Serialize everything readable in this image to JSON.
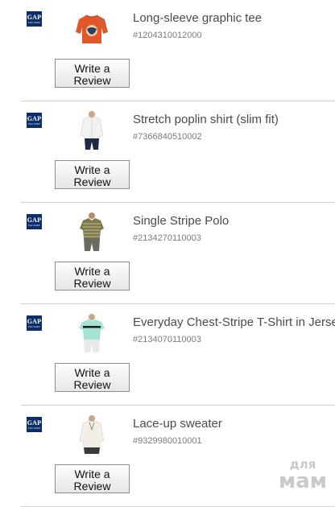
{
  "brand": {
    "logo_text": "GAP",
    "logo_subtext": "FACTORY",
    "logo_color": "#0b2e6b"
  },
  "review_button_label_line1": "Write a",
  "review_button_label_line2": "Review",
  "products": [
    {
      "title": "Long-sleeve graphic tee",
      "sku": "#1204310012000",
      "image": "orange-graphic-tee"
    },
    {
      "title": "Stretch poplin shirt (slim fit)",
      "sku": "#7366840510002",
      "image": "white-poplin-shirt"
    },
    {
      "title": "Single Stripe Polo",
      "sku": "#2134270110003",
      "image": "olive-stripe-polo"
    },
    {
      "title": "Everyday Chest-Stripe T-Shirt in Jersey",
      "sku": "#2134070110003",
      "image": "mint-chest-stripe-tee"
    },
    {
      "title": "Lace-up sweater",
      "sku": "#9329980010001",
      "image": "cream-lace-up-sweater"
    }
  ],
  "watermark": {
    "line1": "для",
    "line2": "мам"
  }
}
